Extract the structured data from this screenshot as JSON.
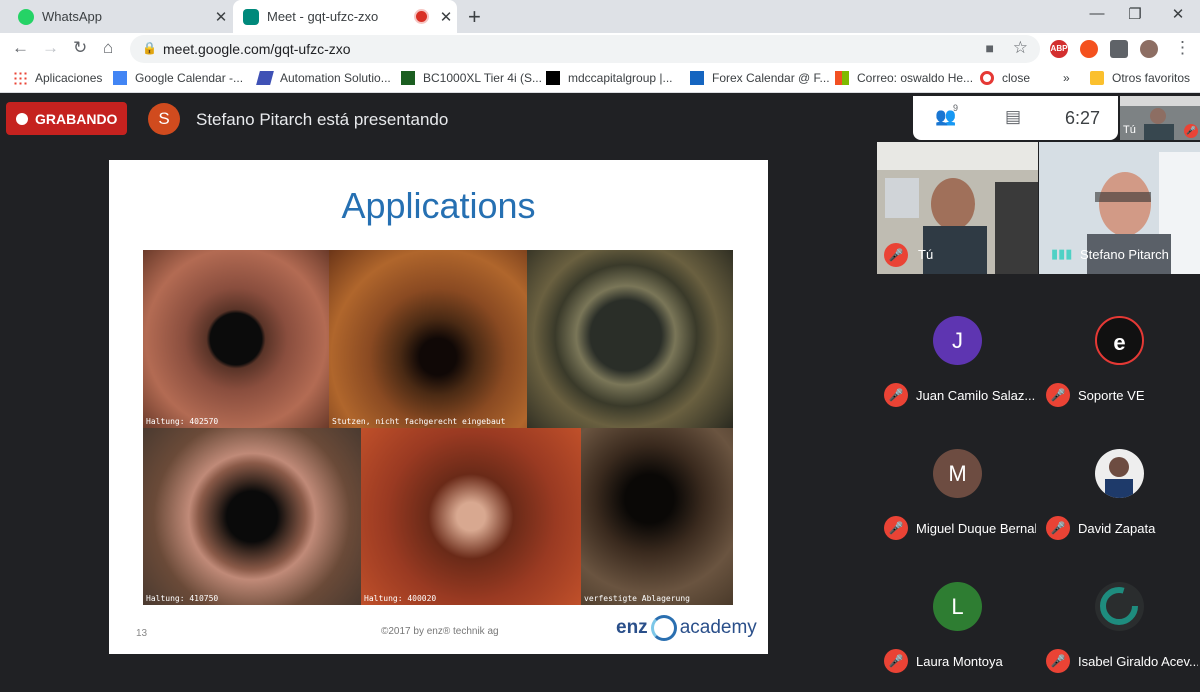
{
  "browser": {
    "tabs": [
      {
        "title": "WhatsApp",
        "icon": "whatsapp-icon",
        "active": false
      },
      {
        "title": "Meet - gqt-ufzc-zxo",
        "icon": "meet-icon",
        "active": true
      }
    ],
    "url": "meet.google.com/gqt-ufzc-zxo",
    "bookmarks": [
      {
        "label": "Aplicaciones",
        "icon": "apps-grid-icon"
      },
      {
        "label": "Google Calendar -...",
        "icon": "calendar-icon"
      },
      {
        "label": "Automation Solutio...",
        "icon": "automation-icon"
      },
      {
        "label": "BC1000XL Tier 4i (S...",
        "icon": "v-logo-icon"
      },
      {
        "label": "mdccapitalgroup |...",
        "icon": "wix-icon"
      },
      {
        "label": "Forex Calendar @ F...",
        "icon": "forex-icon"
      },
      {
        "label": "Correo: oswaldo He...",
        "icon": "microsoft-icon"
      },
      {
        "label": "close",
        "icon": "opera-icon"
      }
    ],
    "bookmarks_overflow": "»",
    "other_bookmarks": "Otros favoritos",
    "ext_abp": "ABP"
  },
  "meet": {
    "recording_label": "GRABANDO",
    "presenter_initial": "S",
    "presenter_text": "Stefano Pitarch está presentando",
    "clock": "6:27",
    "people_count": "9",
    "self_thumb_label": "Tú"
  },
  "slide": {
    "title": "Applications",
    "number": "13",
    "copyright": "©2017 by enz® technik ag",
    "logo_enz": "enz",
    "logo_academy": "academy",
    "photos": [
      {
        "caption": "Haltung: 402570"
      },
      {
        "caption": "Stutzen, nicht fachgerecht eingebaut"
      },
      {
        "caption": ""
      },
      {
        "caption": "Haltung: 410750"
      },
      {
        "caption": "Haltung: 400020"
      },
      {
        "caption": "verfestigte Ablagerung"
      }
    ]
  },
  "video_tiles": [
    {
      "name": "Tú"
    },
    {
      "name": "Stefano Pitarch"
    }
  ],
  "participants": [
    {
      "name": "Juan Camilo Salaz...",
      "initial": "J",
      "color": "#5e35b1"
    },
    {
      "name": "Soporte VE",
      "initial": "e",
      "color": "#111111"
    },
    {
      "name": "Miguel Duque Bernal",
      "initial": "M",
      "color": "#6d4c41"
    },
    {
      "name": "David Zapata",
      "initial": "",
      "color": "#eeeeee"
    },
    {
      "name": "Laura Montoya",
      "initial": "L",
      "color": "#2e7d32"
    },
    {
      "name": "Isabel Giraldo Acev...",
      "initial": "",
      "color": "#2a2d2e"
    }
  ]
}
